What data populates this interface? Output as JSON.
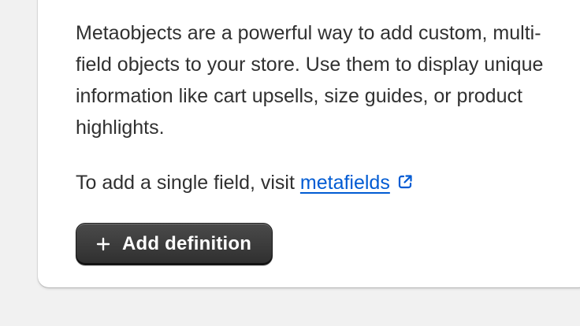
{
  "card": {
    "description": "Metaobjects are a powerful way to add custom, multi-field objects to your store. Use them to display unique information like cart upsells, size guides, or product highlights.",
    "single_field_prefix": "To add a single field, visit ",
    "metafields_link": "metafields",
    "add_button_label": "Add definition",
    "icons": {
      "external_link": "external-link-icon",
      "plus": "plus-icon"
    }
  },
  "colors": {
    "link": "#005bd3",
    "button_bg": "#303030",
    "text": "#303030",
    "page_bg": "#f1f1f1",
    "card_bg": "#ffffff"
  }
}
